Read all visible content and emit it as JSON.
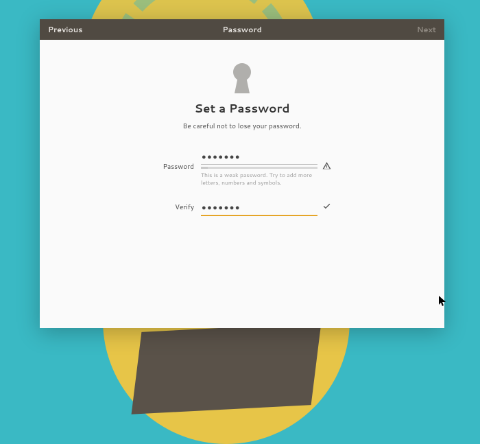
{
  "topbar": {
    "previous": "Previous",
    "title": "Password",
    "next": "Next"
  },
  "icon": "keyhole-icon",
  "heading": "Set a Password",
  "subheading": "Be careful not to lose your password.",
  "password": {
    "label": "Password",
    "value": "●●●●●●●",
    "strength_hint": "This is a weak password. Try to add more letters, numbers and symbols.",
    "status_icon": "warning-icon"
  },
  "verify": {
    "label": "Verify",
    "value": "●●●●●●●",
    "status_icon": "checkmark-icon"
  },
  "colors": {
    "accent": "#e5a528",
    "topbar_bg": "#504a42",
    "background": "#3ab9c4"
  }
}
